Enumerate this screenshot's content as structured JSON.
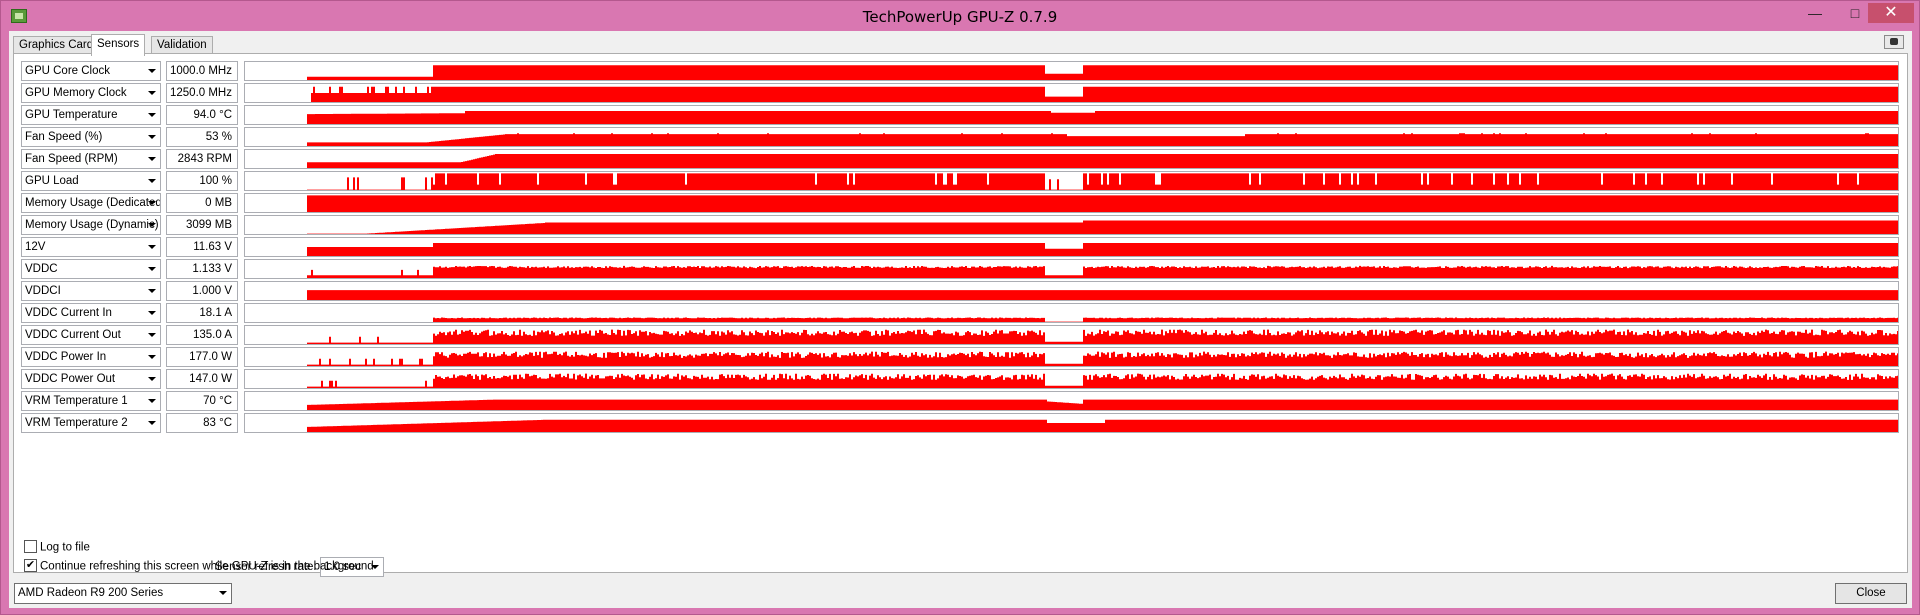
{
  "window": {
    "title": "TechPowerUp GPU-Z 0.7.9",
    "minimize": "—",
    "maximize": "□",
    "close": "✕"
  },
  "tabs": [
    {
      "label": "Graphics Card"
    },
    {
      "label": "Sensors"
    },
    {
      "label": "Validation"
    }
  ],
  "active_tab": "Sensors",
  "graph_color": "#ff0000",
  "sensors": [
    {
      "name": "GPU Core Clock",
      "value": "1000.0 MHz",
      "profile": "clock"
    },
    {
      "name": "GPU Memory Clock",
      "value": "1250.0 MHz",
      "profile": "memclock"
    },
    {
      "name": "GPU Temperature",
      "value": "94.0 °C",
      "profile": "temp"
    },
    {
      "name": "Fan Speed (%)",
      "value": "53 %",
      "profile": "fan"
    },
    {
      "name": "Fan Speed (RPM)",
      "value": "2843 RPM",
      "profile": "fanrpm"
    },
    {
      "name": "GPU Load",
      "value": "100 %",
      "profile": "load"
    },
    {
      "name": "Memory Usage (Dedicated)",
      "value": "0 MB",
      "profile": "full"
    },
    {
      "name": "Memory Usage (Dynamic)",
      "value": "3099 MB",
      "profile": "memdyn"
    },
    {
      "name": "12V",
      "value": "11.63 V",
      "profile": "v12"
    },
    {
      "name": "VDDC",
      "value": "1.133 V",
      "profile": "vddc"
    },
    {
      "name": "VDDCI",
      "value": "1.000 V",
      "profile": "flat"
    },
    {
      "name": "VDDC Current In",
      "value": "18.1 A",
      "profile": "curin"
    },
    {
      "name": "VDDC Current Out",
      "value": "135.0 A",
      "profile": "noisy"
    },
    {
      "name": "VDDC Power In",
      "value": "177.0 W",
      "profile": "noisy"
    },
    {
      "name": "VDDC Power Out",
      "value": "147.0 W",
      "profile": "noisy"
    },
    {
      "name": "VRM Temperature 1",
      "value": "70 °C",
      "profile": "vrm1"
    },
    {
      "name": "VRM Temperature 2",
      "value": "83 °C",
      "profile": "vrm2"
    }
  ],
  "footer": {
    "log_to_file": {
      "label": "Log to file",
      "checked": false
    },
    "refresh_label": "Sensor refresh rate:",
    "refresh_value": "1.0 sec",
    "continue_refresh": {
      "label": "Continue refreshing this screen while GPU-Z is in the background",
      "checked": true,
      "mark": "✔"
    }
  },
  "gpu_select": "AMD Radeon R9 200 Series",
  "close_button": "Close"
}
